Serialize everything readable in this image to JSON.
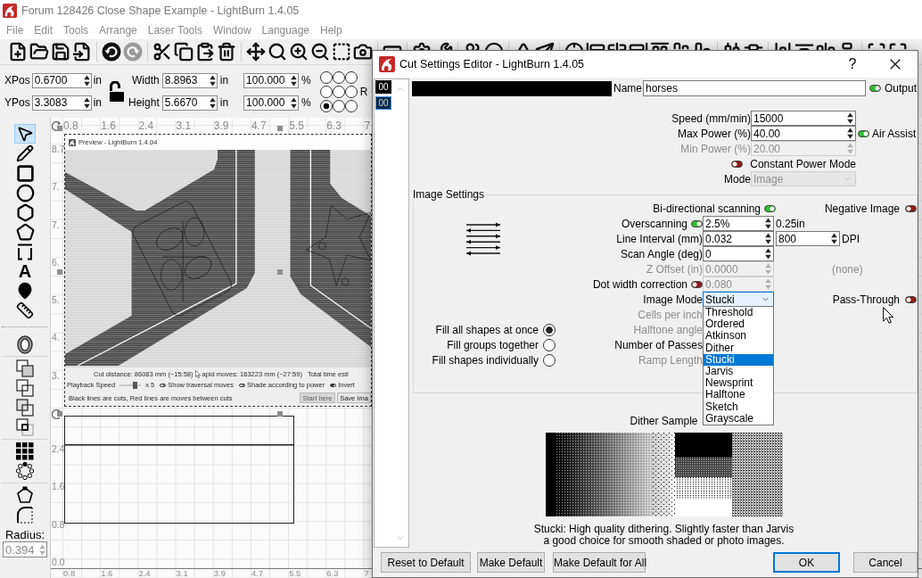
{
  "window": {
    "title": "Forum 128426 Close Shape Example - LightBurn 1.4.05"
  },
  "menu": [
    "File",
    "Edit",
    "Tools",
    "Arrange",
    "Laser Tools",
    "Window",
    "Language",
    "Help"
  ],
  "toolbar": [
    [
      {
        "kind": "new-file",
        "disabled": false
      },
      {
        "kind": "open",
        "disabled": false
      },
      {
        "kind": "save",
        "disabled": false
      },
      {
        "kind": "import",
        "disabled": false
      }
    ],
    [
      {
        "kind": "undo",
        "disabled": false
      },
      {
        "kind": "redo",
        "disabled": true
      }
    ],
    [
      {
        "kind": "cut",
        "disabled": false
      },
      {
        "kind": "copy",
        "disabled": false
      },
      {
        "kind": "paste",
        "disabled": false
      },
      {
        "kind": "delete",
        "disabled": false
      }
    ],
    [
      {
        "kind": "move",
        "disabled": false
      },
      {
        "kind": "zoom-page",
        "disabled": false
      },
      {
        "kind": "zoom-in",
        "disabled": false
      },
      {
        "kind": "zoom-out",
        "disabled": false
      },
      {
        "kind": "frame",
        "disabled": false
      },
      {
        "kind": "camera",
        "disabled": false
      }
    ],
    [
      {
        "kind": "rectangle",
        "disabled": false
      }
    ],
    [
      {
        "kind": "settings",
        "disabled": false
      },
      {
        "kind": "wrench",
        "disabled": false
      }
    ],
    [
      {
        "kind": "people",
        "disabled": false
      },
      {
        "kind": "user",
        "disabled": false
      }
    ],
    [
      {
        "kind": "triangle",
        "disabled": false
      },
      {
        "kind": "send",
        "disabled": false
      }
    ],
    [
      {
        "kind": "crosshair",
        "disabled": false
      },
      {
        "kind": "align-left",
        "disabled": false
      },
      {
        "kind": "align-center",
        "disabled": false
      },
      {
        "kind": "align-right",
        "disabled": false
      },
      {
        "kind": "align-top",
        "disabled": false
      },
      {
        "kind": "align-middle",
        "disabled": false
      },
      {
        "kind": "align-bottom",
        "disabled": false
      }
    ],
    [
      {
        "kind": "distribute-h",
        "disabled": false
      },
      {
        "kind": "distribute-v",
        "disabled": false
      }
    ],
    [
      {
        "kind": "space-h",
        "disabled": false
      },
      {
        "kind": "space-v",
        "disabled": false
      },
      {
        "kind": "justify-h",
        "disabled": false
      },
      {
        "kind": "justify-v",
        "disabled": false
      }
    ],
    [
      {
        "kind": "corners",
        "disabled": false
      },
      {
        "kind": "maximize",
        "disabled": false
      }
    ]
  ],
  "position": [
    {
      "label": "XPos",
      "value": "0.6700",
      "unit": "in"
    },
    {
      "label": "YPos",
      "value": "3.3083",
      "unit": "in"
    }
  ],
  "lock": {
    "locked": false
  },
  "size": [
    {
      "label": "Width",
      "value": "8.8963",
      "unit": "in",
      "percent": "100.000",
      "percent_unit": "%"
    },
    {
      "label": "Height",
      "value": "5.6670",
      "unit": "in",
      "percent": "100.000",
      "percent_unit": "%"
    }
  ],
  "anchor": [
    {
      "selected": false
    },
    {
      "selected": false
    },
    {
      "selected": false
    },
    {
      "selected": false
    },
    {
      "selected": false
    },
    {
      "selected": false
    },
    {
      "selected": true
    },
    {
      "selected": false
    },
    {
      "selected": false
    }
  ],
  "partial_label": "R",
  "tool_groups": [
    {
      "tools": [
        {
          "kind": "select",
          "selected": true
        },
        {
          "kind": "pen",
          "selected": false
        },
        {
          "kind": "rectangle",
          "selected": false
        },
        {
          "kind": "ellipse",
          "selected": false
        },
        {
          "kind": "polygon",
          "selected": false
        },
        {
          "kind": "pentagon",
          "selected": false
        },
        {
          "kind": "bracket",
          "selected": false
        },
        {
          "kind": "text",
          "glyph": "A",
          "selected": false
        },
        {
          "kind": "position",
          "selected": false
        },
        {
          "kind": "measure",
          "selected": false
        }
      ]
    },
    {
      "tools": [
        {
          "kind": "offset",
          "selected": false
        }
      ]
    },
    {
      "tools": [
        {
          "kind": "weld",
          "selected": false
        },
        {
          "kind": "union",
          "selected": false
        },
        {
          "kind": "subtract",
          "selected": false
        },
        {
          "kind": "intersect",
          "selected": false
        }
      ]
    },
    {
      "tools": [
        {
          "kind": "grid-array",
          "selected": false
        },
        {
          "kind": "circular-array",
          "selected": false
        }
      ]
    },
    {
      "tools": [
        {
          "kind": "node-edit",
          "selected": false
        },
        {
          "kind": "corner",
          "selected": false
        }
      ]
    }
  ],
  "radius": {
    "label": "Radius:",
    "value": "0.394",
    "disabled": true
  },
  "canvas": {
    "top_ruler": [
      "0.8",
      "1.6",
      "2.4",
      "3.1",
      "3.9",
      "4.7",
      "5.5",
      "6.3",
      "7"
    ],
    "left_ruler_upper": [
      "8.7",
      "7.",
      "7.",
      "6.",
      "5.",
      "4.",
      "3."
    ],
    "left_ruler_lower": [
      "2.4",
      "1.6",
      "0.8",
      "0.0"
    ],
    "bottom_ruler": [
      "0.8",
      "1.6",
      "2.4",
      "3.1",
      "3.9",
      "4.7",
      "5.5",
      "6.3",
      "7"
    ]
  },
  "preview_window": {
    "title": "Preview - LightBurn 1.4.04",
    "stats": [
      "Cut distance: 86083 mm (~15:58)",
      "apid moves: 163223 mm (~27:59)",
      "Total time esti"
    ],
    "playback": {
      "label": "Playback Speed",
      "level": 0.7,
      "reading": "x 5"
    },
    "toggles": [
      {
        "label": "Show traversal moves",
        "on": false
      },
      {
        "label": "Shade according to power",
        "on": false
      },
      {
        "label": "Invert",
        "on": true
      }
    ],
    "legend": "Black lines are cuts, Red lines are moves between cuts",
    "buttons": [
      {
        "label": "Start here",
        "disabled": true
      },
      {
        "label": "Save Ima",
        "disabled": false
      }
    ]
  },
  "dialog": {
    "title": "Cut Settings Editor - LightBurn 1.4.05",
    "help": "?",
    "layers": [
      {
        "label": "00",
        "selected": false
      },
      {
        "label": "00",
        "selected": true
      }
    ],
    "name": {
      "label": "Name",
      "value": "horses"
    },
    "output": {
      "label": "Output",
      "on": true
    },
    "fields": [
      {
        "label": "Speed (mm/min)",
        "value": "15000",
        "disabled": false
      },
      {
        "label": "Max Power (%)",
        "value": "40.00",
        "disabled": false
      },
      {
        "label": "Min Power (%)",
        "value": "20.00",
        "disabled": true
      }
    ],
    "air_assist": {
      "label": "Air Assist",
      "on": true
    },
    "constant_power": {
      "label": "Constant Power Mode",
      "on": false
    },
    "mode": {
      "label": "Mode",
      "value": "Image",
      "disabled": true
    },
    "image_settings": {
      "title": "Image Settings",
      "bidirectional": {
        "label": "Bi-directional scanning",
        "on": true
      },
      "negative_image": {
        "label": "Negative Image",
        "on": false
      },
      "overscanning": {
        "label": "Overscanning",
        "on": true,
        "value": "2.5%",
        "reading": "0.25in"
      },
      "line_interval": {
        "label": "Line Interval (mm)",
        "value": "0.032",
        "dpi": "800",
        "dpi_unit": "DPI"
      },
      "scan_angle": {
        "label": "Scan Angle (deg)",
        "value": "0"
      },
      "z_offset": {
        "label": "Z Offset (in)",
        "value": "0.0000",
        "disabled": true,
        "note": "(none)"
      },
      "dot_width": {
        "label": "Dot width correction",
        "on": false,
        "value": "0.080",
        "disabled": true
      },
      "image_mode": {
        "label": "Image Mode",
        "value": "Stucki",
        "expanded": true,
        "options": [
          {
            "label": "Threshold",
            "selected": false
          },
          {
            "label": "Ordered",
            "selected": false
          },
          {
            "label": "Atkinson",
            "selected": false
          },
          {
            "label": "Dither",
            "selected": false
          },
          {
            "label": "Stucki",
            "selected": true
          },
          {
            "label": "Jarvis",
            "selected": false
          },
          {
            "label": "Newsprint",
            "selected": false
          },
          {
            "label": "Halftone",
            "selected": false
          },
          {
            "label": "Sketch",
            "selected": false
          },
          {
            "label": "Grayscale",
            "selected": false
          }
        ]
      },
      "pass_through": {
        "label": "Pass-Through",
        "on": false
      },
      "more_labels": [
        {
          "label": "Cells per inch",
          "disabled": true
        },
        {
          "label": "Halftone angle",
          "disabled": true
        },
        {
          "label": "Number of Passes",
          "disabled": false
        },
        {
          "label": "Ramp Length",
          "disabled": true
        }
      ],
      "fill_modes": [
        {
          "label": "Fill all shapes at once",
          "selected": true
        },
        {
          "label": "Fill groups together",
          "selected": false
        },
        {
          "label": "Fill shapes individually",
          "selected": false
        }
      ]
    },
    "dither_sample": {
      "label": "Dither Sample",
      "description": [
        "Stucki: High quality dithering. Slightly faster than Jarvis",
        "a good choice for smooth shaded or photo images."
      ]
    },
    "buttons_left": [
      {
        "label": "Reset to Default",
        "default": false
      },
      {
        "label": "Make Default",
        "default": false
      },
      {
        "label": "Make Default for All",
        "default": false
      }
    ],
    "buttons_right": [
      {
        "label": "OK",
        "default": true
      },
      {
        "label": "Cancel",
        "default": false
      }
    ]
  }
}
